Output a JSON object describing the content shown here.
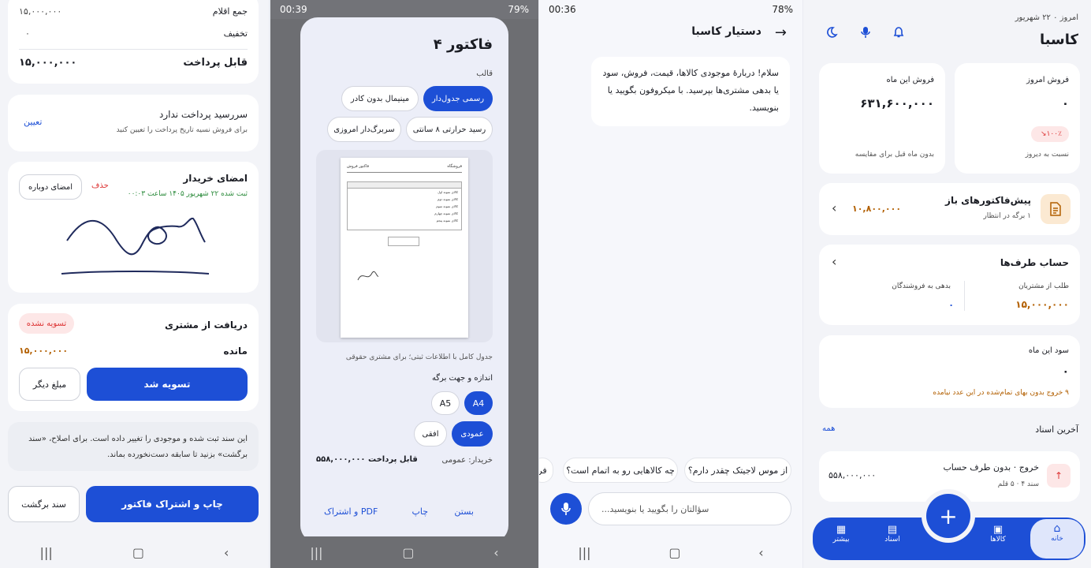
{
  "s1": {
    "summary": {
      "items_total_label": "جمع اقلام",
      "items_total_value": "۱۵,۰۰۰,۰۰۰",
      "discount_label": "تخفیف",
      "discount_value": "۰",
      "payable_label": "قابل پرداخت",
      "payable_value": "۱۵,۰۰۰,۰۰۰"
    },
    "due": {
      "title": "سررسید پرداخت ندارد",
      "subtitle": "برای فروش نسیه تاریخ پرداخت را تعیین کنید",
      "action": "تعیین"
    },
    "signature": {
      "title": "امضای خریدار",
      "registered": "ثبت شده ۲۲ شهریور ۱۴۰۵ ساعت ۰۰:۰۳",
      "delete": "حذف",
      "resign": "امضای دوباره"
    },
    "receive": {
      "title": "دریافت از مشتری",
      "status": "تسویه نشده",
      "remaining_label": "مانده",
      "remaining_value": "۱۵,۰۰۰,۰۰۰",
      "settle": "تسویه شد",
      "other_amount": "مبلغ دیگر"
    },
    "notice": "این سند ثبت شده و موجودی را تغییر داده است. برای اصلاح، «سند برگشت» بزنید تا سابقه دست‌نخورده بماند.",
    "print_share": "چاپ و اشتراک فاکتور",
    "return_doc": "سند برگشت"
  },
  "s2": {
    "status": {
      "time": "00:39",
      "battery": "79%"
    },
    "title": "فاکتور ۴",
    "template_label": "قالب",
    "templates": [
      "رسمی جدول‌دار",
      "مینیمال بدون کادر",
      "رسید حرارتی ۸ سانتی",
      "سربرگ‌دار امروزی"
    ],
    "preview": {
      "shop": "فروشگاه",
      "invoice": "فاکتور فروش",
      "rows": [
        "کالای نمونه اول",
        "کالای نمونه دوم",
        "کالای نمونه سوم",
        "کالای نمونه چهارم",
        "کالای نمونه پنجم"
      ]
    },
    "template_desc": "جدول کامل با اطلاعات ثبتی؛ برای مشتری حقوقی",
    "size_label": "اندازه و جهت برگه",
    "sizes": [
      "A4",
      "A5"
    ],
    "orientations": [
      "عمودی",
      "افقی"
    ],
    "buyer": "خریدار: عمومی",
    "payable": "قابل پرداخت ۵۵۸,۰۰۰,۰۰۰",
    "actions": {
      "close": "بستن",
      "print": "چاپ",
      "pdf": "PDF و اشتراک"
    }
  },
  "s3": {
    "status": {
      "time": "00:36",
      "battery": "78%"
    },
    "title": "دستیار کاسبا",
    "message": "سلام! دربارهٔ موجودی کالاها، قیمت، فروش، سود یا بدهی مشتری‌ها بپرسید. با میکروفون بگویید یا بنویسید.",
    "suggestions": [
      "از موس لاجیتک چقدر دارم؟",
      "چه کالاهایی رو به اتمام است؟",
      "فر"
    ],
    "input_placeholder": "سؤالتان را بگویید یا بنویسید..."
  },
  "s4": {
    "date": "امروز ۰ ۲۲ شهریور",
    "app": "کاسبا",
    "today_sales": {
      "label": "فروش امروز",
      "value": "۰",
      "badge": "۱۰۰٪",
      "note": "نسبت به دیروز"
    },
    "month_sales": {
      "label": "فروش این ماه",
      "value": "۶۳۱,۶۰۰,۰۰۰",
      "note": "بدون ماه قبل برای مقایسه"
    },
    "proforma": {
      "title": "پیش‌فاکتورهای باز",
      "sub": "۱ برگه در انتظار",
      "value": "۱۰,۸۰۰,۰۰۰"
    },
    "accounts": {
      "title": "حساب طرف‌ها",
      "receivable_label": "طلب از مشتریان",
      "receivable_value": "۱۵,۰۰۰,۰۰۰",
      "payable_label": "بدهی به فروشندگان",
      "payable_value": "۰"
    },
    "profit": {
      "label": "سود این ماه",
      "value": "۰",
      "warning": "۹ خروج بدون بهای تمام‌شده در این عدد نیامده"
    },
    "recent": {
      "title": "آخرین اسناد",
      "all": "همه",
      "doc_title": "خروج · بدون طرف حساب",
      "doc_sub": "سند ۴ · ۵ قلم",
      "doc_value": "۵۵۸,۰۰۰,۰۰۰"
    },
    "nav": [
      "خانه",
      "کالاها",
      "اسناد",
      "بیشتر"
    ]
  },
  "colors": {
    "accent": "#1d4fd6",
    "bg": "#f3f4f8",
    "orange": "#b25f00",
    "green": "#2a8a3a",
    "danger": "#d33"
  }
}
